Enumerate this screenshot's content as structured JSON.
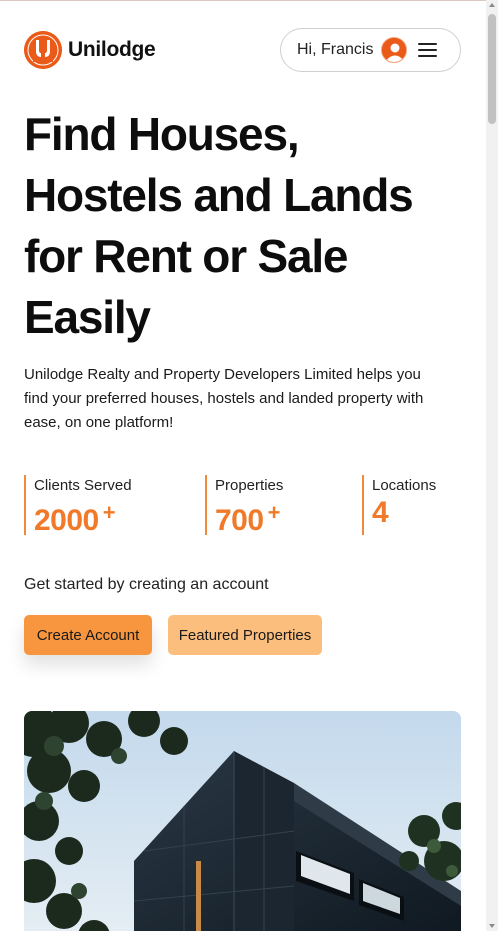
{
  "header": {
    "brand_name": "Unilodge",
    "logo_text": "UNILODGE",
    "greeting": "Hi, Francis"
  },
  "hero": {
    "title": "Find Houses, Hostels and Lands for Rent or Sale Easily",
    "description": "Unilodge Realty and Property Developers Limited helps you find your preferred houses, hostels and landed property with ease, on one platform!"
  },
  "stats": [
    {
      "label": "Clients Served",
      "value": "2000",
      "suffix": "+"
    },
    {
      "label": "Properties",
      "value": "700",
      "suffix": "+"
    },
    {
      "label": "Locations",
      "value": "4",
      "suffix": ""
    }
  ],
  "cta": {
    "text": "Get started by creating an account",
    "primary_label": "Create Account",
    "secondary_label": "Featured Properties"
  },
  "colors": {
    "accent": "#f07a2a",
    "brand": "#ea5a18",
    "primary_button": "#f8963f",
    "secondary_button": "#fbbe7d"
  },
  "icons": {
    "logo": "unilodge-logo-icon",
    "avatar": "user-avatar-icon",
    "menu": "hamburger-menu-icon"
  }
}
